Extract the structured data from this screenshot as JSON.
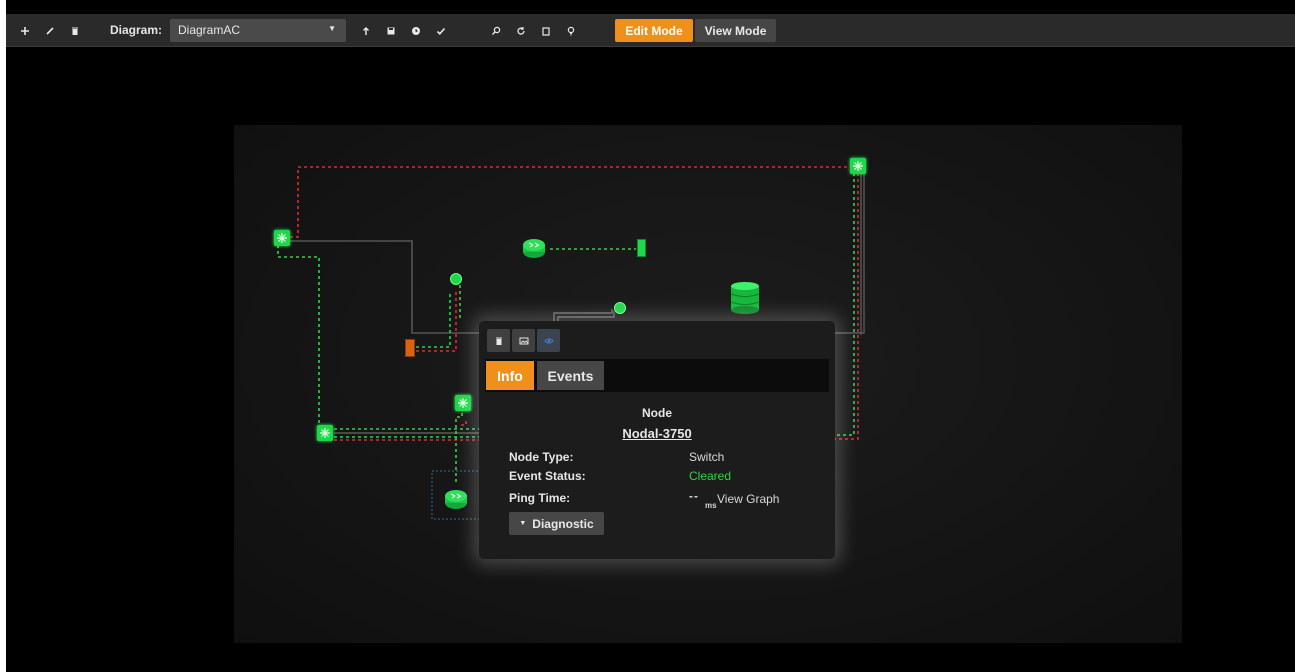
{
  "toolbar": {
    "left_buttons": [
      "add-icon",
      "edit-pencil-icon",
      "trash-icon"
    ],
    "diagram_label": "Diagram:",
    "diagram_value": "DiagramAC",
    "mid_buttons": [
      "upload-icon",
      "save-icon",
      "clock-icon",
      "check-icon"
    ],
    "right_buttons": [
      "search-icon",
      "refresh-icon",
      "copy-icon",
      "lightbulb-icon"
    ],
    "edit_mode_label": "Edit Mode",
    "view_mode_label": "View Mode",
    "active_mode": "Edit Mode"
  },
  "popup": {
    "tool_buttons": [
      "trash-icon",
      "image-icon",
      "eye-icon"
    ],
    "tabs": [
      {
        "label": "Info",
        "active": true
      },
      {
        "label": "Events",
        "active": false
      }
    ],
    "heading": "Node",
    "node_name": "Nodal-3750",
    "rows": {
      "node_type_label": "Node Type:",
      "node_type_value": "Switch",
      "event_status_label": "Event Status:",
      "event_status_value": "Cleared",
      "ping_time_label": "Ping Time:",
      "ping_time_value": "--",
      "ping_time_unit": "ms",
      "view_graph_label": "View Graph"
    },
    "diagnostic_label": "Diagnostic"
  },
  "colors": {
    "accent": "#f0901a",
    "node_green": "#1ed84a",
    "link_red": "#e02a2a",
    "link_green": "#2fd34a",
    "status_cleared": "#2fd34a"
  }
}
